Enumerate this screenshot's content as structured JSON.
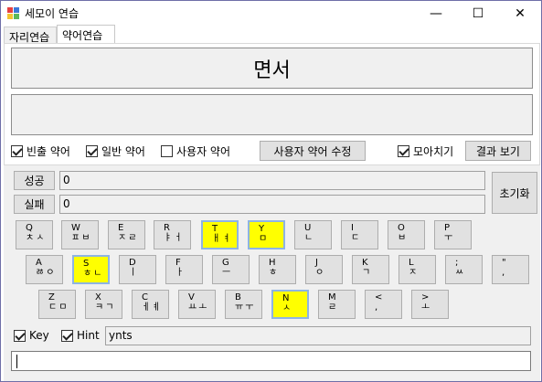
{
  "window": {
    "title": "세모이 연습",
    "minimize": "—",
    "maximize": "☐",
    "close": "✕"
  },
  "tabs": [
    {
      "label": "자리연습"
    },
    {
      "label": "약어연습"
    }
  ],
  "word": "면서",
  "options": {
    "frequent": {
      "label": "빈출 약어",
      "checked": true
    },
    "general": {
      "label": "일반 약어",
      "checked": true
    },
    "user": {
      "label": "사용자 약어",
      "checked": false
    },
    "edit_button": "사용자 약어 수정",
    "moa": {
      "label": "모아치기",
      "checked": true
    },
    "result_button": "결과 보기"
  },
  "stats": {
    "success_label": "성공",
    "success_value": "0",
    "fail_label": "실패",
    "fail_value": "0",
    "reset_button": "초기화"
  },
  "keyboard": {
    "rows": [
      [
        {
          "k": "Q",
          "h": "ㅊㅅ"
        },
        {
          "k": "W",
          "h": "ㅍㅂ"
        },
        {
          "k": "E",
          "h": "ㅈㄹ"
        },
        {
          "k": "R",
          "h": "ㅑㅓ"
        },
        {
          "k": "T",
          "h": "ㅐㅕ",
          "hl": true
        },
        {
          "k": "Y",
          "h": "ㅁ",
          "hl": true
        },
        {
          "k": "U",
          "h": "ㄴ"
        },
        {
          "k": "I",
          "h": "ㄷ"
        },
        {
          "k": "O",
          "h": "ㅂ"
        },
        {
          "k": "P",
          "h": "ㅜ"
        }
      ],
      [
        {
          "k": "A",
          "h": "ㅀㅇ"
        },
        {
          "k": "S",
          "h": "ㅎㄴ",
          "hl": true
        },
        {
          "k": "D",
          "h": "ㅣ"
        },
        {
          "k": "F",
          "h": "ㅏ"
        },
        {
          "k": "G",
          "h": "ㅡ"
        },
        {
          "k": "H",
          "h": "ㅎ"
        },
        {
          "k": "J",
          "h": "ㅇ"
        },
        {
          "k": "K",
          "h": "ㄱ"
        },
        {
          "k": "L",
          "h": "ㅈ"
        },
        {
          "k": ";",
          "h": "ㅆ"
        },
        {
          "k": "\"",
          "h": ","
        }
      ],
      [
        {
          "k": "Z",
          "h": "ㄷㅁ"
        },
        {
          "k": "X",
          "h": "ㅋㄱ"
        },
        {
          "k": "C",
          "h": "ㅔㅖ"
        },
        {
          "k": "V",
          "h": "ㅛㅗ"
        },
        {
          "k": "B",
          "h": "ㅠㅜ"
        },
        {
          "k": "N",
          "h": "ㅅ",
          "hl": true
        },
        {
          "k": "M",
          "h": "ㄹ"
        },
        {
          "k": "<",
          "h": ","
        },
        {
          "k": ">",
          "h": "ㅗ"
        }
      ]
    ]
  },
  "bottom": {
    "key": {
      "label": "Key",
      "checked": true
    },
    "hint": {
      "label": "Hint",
      "checked": true
    },
    "hint_value": "ynts"
  },
  "colors": {
    "highlight": "#ffff00",
    "highlight_border": "#8eb4e3",
    "background": "#f0f0f0"
  }
}
